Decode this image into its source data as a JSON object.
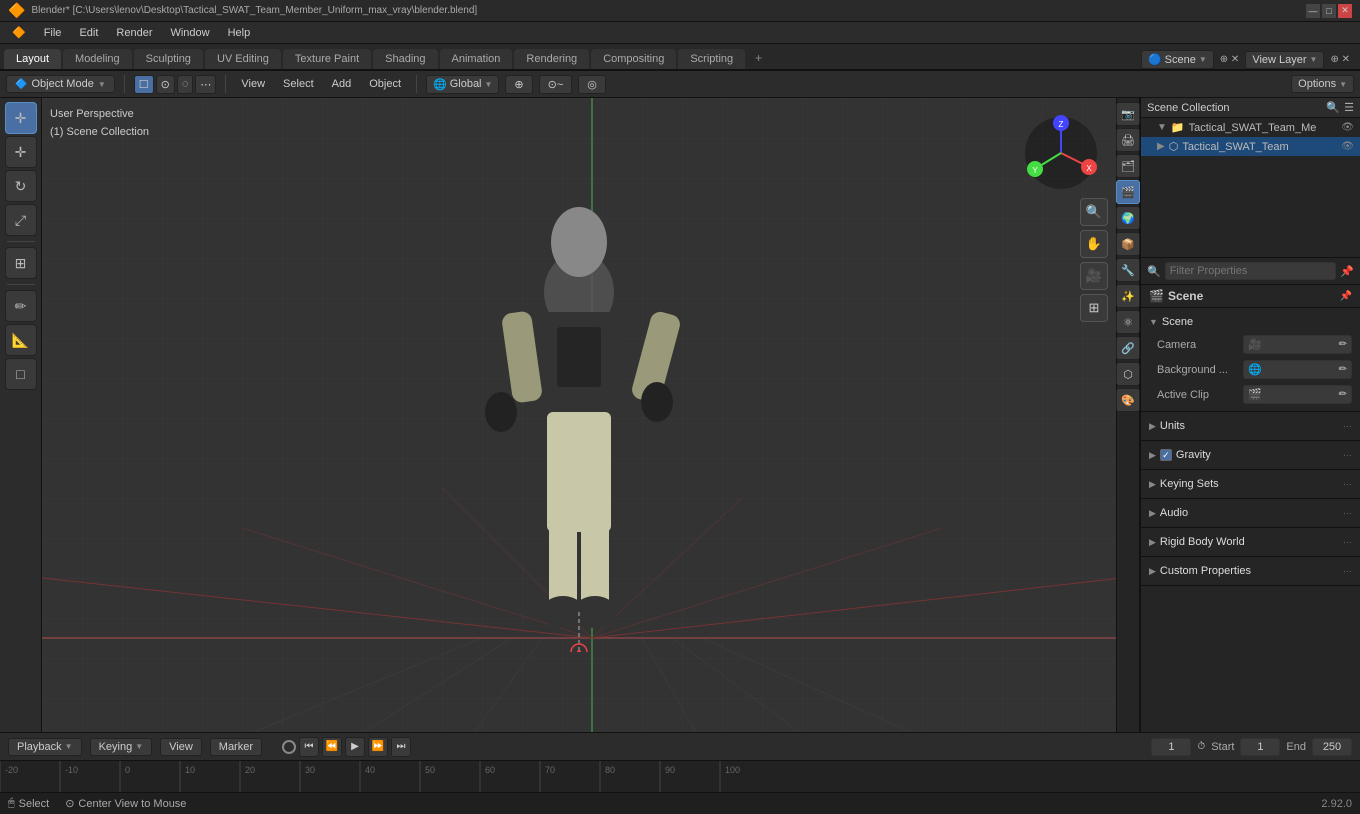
{
  "titlebar": {
    "title": "Blender* [C:\\Users\\lenov\\Desktop\\Tactical_SWAT_Team_Member_Uniform_max_vray\\blender.blend]",
    "controls": [
      "—",
      "□",
      "✕"
    ]
  },
  "menubar": {
    "items": [
      "Blender",
      "File",
      "Edit",
      "Render",
      "Window",
      "Help"
    ]
  },
  "tabs": {
    "items": [
      "Layout",
      "Modeling",
      "Sculpting",
      "UV Editing",
      "Texture Paint",
      "Shading",
      "Animation",
      "Rendering",
      "Compositing",
      "Scripting"
    ],
    "active": "Layout"
  },
  "header_toolbar": {
    "mode": "Object Mode",
    "view_label": "View",
    "select_label": "Select",
    "add_label": "Add",
    "object_label": "Object",
    "transform": "Global",
    "pivot": "⊕",
    "snap_label": "⊙",
    "options_label": "Options"
  },
  "viewport": {
    "info_line1": "User Perspective",
    "info_line2": "(1) Scene Collection",
    "overlay_btn": "●"
  },
  "outliner": {
    "title": "Scene Collection",
    "items": [
      {
        "label": "Tactical_SWAT_Team_Me",
        "icon": "📁",
        "indent": 1
      },
      {
        "label": "Tactical_SWAT_Team",
        "icon": "⬡",
        "indent": 2
      }
    ]
  },
  "properties": {
    "scene_header": "Scene",
    "sections": [
      {
        "label": "Scene",
        "expanded": true,
        "rows": [
          {
            "label": "Camera",
            "value": "🎥"
          },
          {
            "label": "Background ...",
            "value": "🌐"
          },
          {
            "label": "Active Clip",
            "value": "🎬"
          }
        ]
      },
      {
        "label": "Units",
        "expanded": false
      },
      {
        "label": "Gravity",
        "expanded": false,
        "checkbox": true,
        "checked": true
      },
      {
        "label": "Keying Sets",
        "expanded": false
      },
      {
        "label": "Audio",
        "expanded": false
      },
      {
        "label": "Rigid Body World",
        "expanded": false
      },
      {
        "label": "Custom Properties",
        "expanded": false
      }
    ]
  },
  "timeline": {
    "playback_label": "Playback",
    "keying_label": "Keying",
    "view_label": "View",
    "marker_label": "Marker",
    "frame_current": "1",
    "frame_start_label": "Start",
    "frame_start": "1",
    "frame_end_label": "End",
    "frame_end": "250"
  },
  "statusbar": {
    "select_label": "Select",
    "center_label": "Center View to Mouse",
    "version": "2.92.0"
  },
  "view_layer": {
    "label": "View Layer"
  },
  "scene_name": "Scene"
}
